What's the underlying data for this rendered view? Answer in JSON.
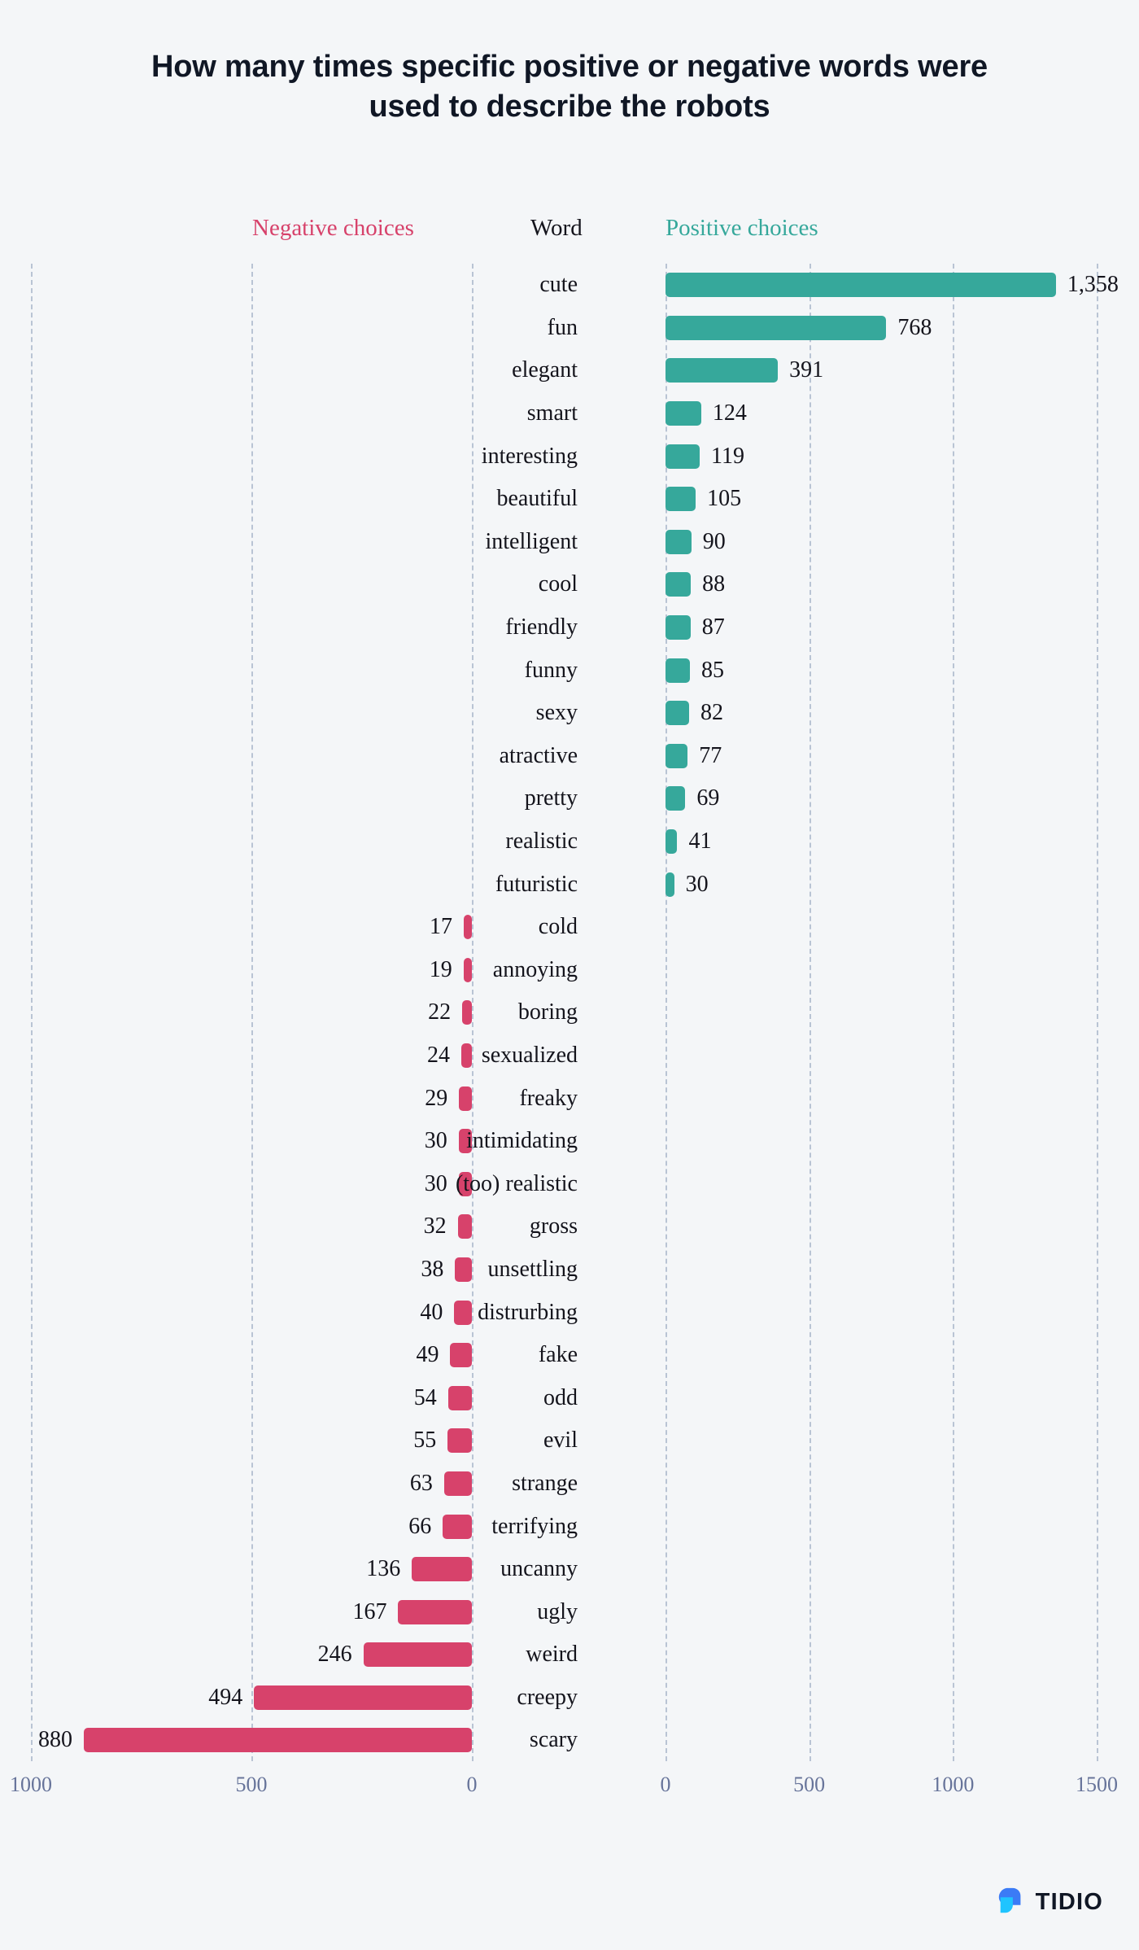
{
  "title": "How many times specific positive or negative words were used to describe the robots",
  "headers": {
    "negative": "Negative choices",
    "word": "Word",
    "positive": "Positive choices"
  },
  "colors": {
    "positive": "#36a89b",
    "negative": "#d7426b",
    "background": "#f4f6f8",
    "gridline": "#b9c4d4",
    "tick_label": "#67749a",
    "title": "#101725"
  },
  "logo": {
    "name": "TIDIO",
    "mark_color_front": "#1fc4ff",
    "mark_color_back": "#3b7bf6"
  },
  "chart_data": {
    "type": "bar",
    "orientation": "horizontal",
    "layout": "diverging-butterfly",
    "title": "How many times specific positive or negative words were used to describe the robots",
    "xlabel": "",
    "ylabel": "Word",
    "grid": true,
    "legend_position": "top",
    "left_axis": {
      "name": "Negative choices",
      "ticks": [
        "1000",
        "500",
        "0"
      ],
      "tick_values": [
        1000,
        500,
        0
      ],
      "xlim": [
        1000,
        0
      ],
      "color": "#d7426b"
    },
    "right_axis": {
      "name": "Positive choices",
      "ticks": [
        "0",
        "500",
        "1000",
        "1500"
      ],
      "tick_values": [
        0,
        500,
        1000,
        1500
      ],
      "xlim": [
        0,
        1500
      ],
      "color": "#36a89b"
    },
    "categories": [
      "cute",
      "fun",
      "elegant",
      "smart",
      "interesting",
      "beautiful",
      "intelligent",
      "cool",
      "friendly",
      "funny",
      "sexy",
      "atractive",
      "pretty",
      "realistic",
      "futuristic",
      "cold",
      "annoying",
      "boring",
      "sexualized",
      "freaky",
      "intimidating",
      "(too) realistic",
      "gross",
      "unsettling",
      "distrurbing",
      "fake",
      "odd",
      "evil",
      "strange",
      "terrifying",
      "uncanny",
      "ugly",
      "weird",
      "creepy",
      "scary"
    ],
    "series": [
      {
        "name": "Positive choices",
        "side": "right",
        "color": "#36a89b",
        "values": [
          1358,
          768,
          391,
          124,
          119,
          105,
          90,
          88,
          87,
          85,
          82,
          77,
          69,
          41,
          30,
          null,
          null,
          null,
          null,
          null,
          null,
          null,
          null,
          null,
          null,
          null,
          null,
          null,
          null,
          null,
          null,
          null,
          null,
          null,
          null
        ]
      },
      {
        "name": "Negative choices",
        "side": "left",
        "color": "#d7426b",
        "values": [
          null,
          null,
          null,
          null,
          null,
          null,
          null,
          null,
          null,
          null,
          null,
          null,
          null,
          null,
          null,
          17,
          19,
          22,
          24,
          29,
          30,
          30,
          32,
          38,
          40,
          49,
          54,
          55,
          63,
          66,
          136,
          167,
          246,
          494,
          880
        ]
      }
    ],
    "rows": [
      {
        "word": "cute",
        "side": "positive",
        "value": 1358,
        "label": "1,358"
      },
      {
        "word": "fun",
        "side": "positive",
        "value": 768,
        "label": "768"
      },
      {
        "word": "elegant",
        "side": "positive",
        "value": 391,
        "label": "391"
      },
      {
        "word": "smart",
        "side": "positive",
        "value": 124,
        "label": "124"
      },
      {
        "word": "interesting",
        "side": "positive",
        "value": 119,
        "label": "119"
      },
      {
        "word": "beautiful",
        "side": "positive",
        "value": 105,
        "label": "105"
      },
      {
        "word": "intelligent",
        "side": "positive",
        "value": 90,
        "label": "90"
      },
      {
        "word": "cool",
        "side": "positive",
        "value": 88,
        "label": "88"
      },
      {
        "word": "friendly",
        "side": "positive",
        "value": 87,
        "label": "87"
      },
      {
        "word": "funny",
        "side": "positive",
        "value": 85,
        "label": "85"
      },
      {
        "word": "sexy",
        "side": "positive",
        "value": 82,
        "label": "82"
      },
      {
        "word": "atractive",
        "side": "positive",
        "value": 77,
        "label": "77"
      },
      {
        "word": "pretty",
        "side": "positive",
        "value": 69,
        "label": "69"
      },
      {
        "word": "realistic",
        "side": "positive",
        "value": 41,
        "label": "41"
      },
      {
        "word": "futuristic",
        "side": "positive",
        "value": 30,
        "label": "30"
      },
      {
        "word": "cold",
        "side": "negative",
        "value": 17,
        "label": "17"
      },
      {
        "word": "annoying",
        "side": "negative",
        "value": 19,
        "label": "19"
      },
      {
        "word": "boring",
        "side": "negative",
        "value": 22,
        "label": "22"
      },
      {
        "word": "sexualized",
        "side": "negative",
        "value": 24,
        "label": "24"
      },
      {
        "word": "freaky",
        "side": "negative",
        "value": 29,
        "label": "29"
      },
      {
        "word": "intimidating",
        "side": "negative",
        "value": 30,
        "label": "30"
      },
      {
        "word": "(too) realistic",
        "side": "negative",
        "value": 30,
        "label": "30"
      },
      {
        "word": "gross",
        "side": "negative",
        "value": 32,
        "label": "32"
      },
      {
        "word": "unsettling",
        "side": "negative",
        "value": 38,
        "label": "38"
      },
      {
        "word": "distrurbing",
        "side": "negative",
        "value": 40,
        "label": "40"
      },
      {
        "word": "fake",
        "side": "negative",
        "value": 49,
        "label": "49"
      },
      {
        "word": "odd",
        "side": "negative",
        "value": 54,
        "label": "54"
      },
      {
        "word": "evil",
        "side": "negative",
        "value": 55,
        "label": "55"
      },
      {
        "word": "strange",
        "side": "negative",
        "value": 63,
        "label": "63"
      },
      {
        "word": "terrifying",
        "side": "negative",
        "value": 66,
        "label": "66"
      },
      {
        "word": "uncanny",
        "side": "negative",
        "value": 136,
        "label": "136"
      },
      {
        "word": "ugly",
        "side": "negative",
        "value": 167,
        "label": "167"
      },
      {
        "word": "weird",
        "side": "negative",
        "value": 246,
        "label": "246"
      },
      {
        "word": "creepy",
        "side": "negative",
        "value": 494,
        "label": "494"
      },
      {
        "word": "scary",
        "side": "negative",
        "value": 880,
        "label": "880"
      }
    ]
  }
}
